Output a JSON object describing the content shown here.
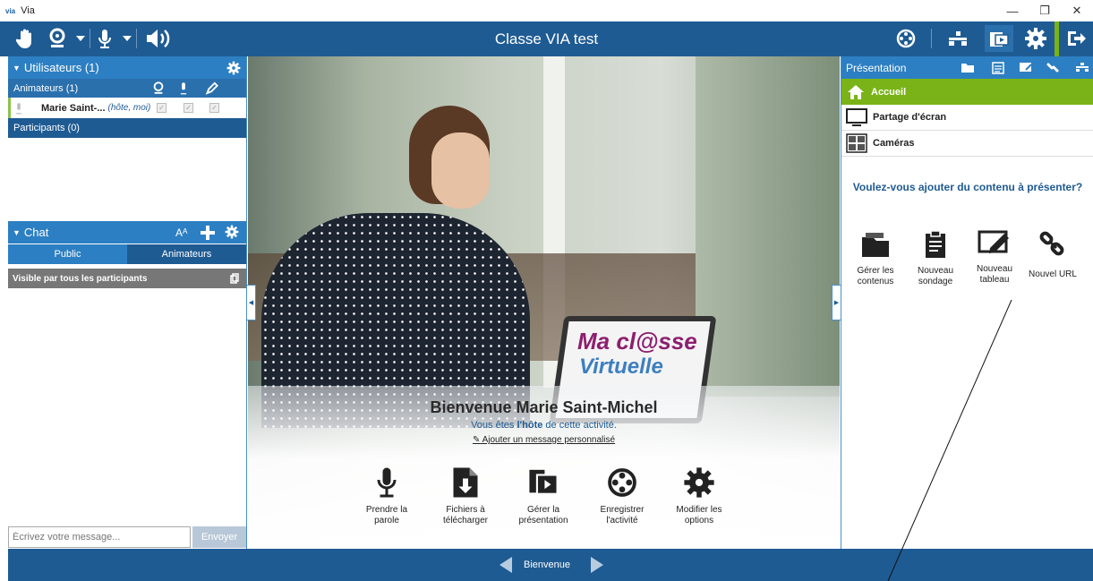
{
  "window": {
    "logo": "via",
    "title": "Via",
    "minimize": "—",
    "restore": "❐",
    "close": "✕"
  },
  "toolbar": {
    "class_title": "Classe VIA test"
  },
  "users": {
    "header": "Utilisateurs (1)",
    "animators_header": "Animateurs (1)",
    "user_name": "Marie Saint-...",
    "user_tag": "(hôte, moi)",
    "participants_header": "Participants (0)"
  },
  "chat": {
    "header": "Chat",
    "font_label": "Aᴬ",
    "tabs": [
      "Public",
      "Animateurs"
    ],
    "visibility": "Visible par tous les participants",
    "input_placeholder": "Écrivez votre message...",
    "send_label": "Envoyer"
  },
  "welcome": {
    "title": "Bienvenue Marie Saint-Michel",
    "subtitle_pre": "Vous êtes ",
    "subtitle_bold": "l'hôte",
    "subtitle_post": " de cette activité.",
    "custom_message_link": "Ajouter un message personnalisé",
    "screen_text_1": "Ma cl@sse",
    "screen_text_2": "Virtuelle",
    "actions": [
      {
        "line1": "Prendre la",
        "line2": "parole",
        "icon": "microphone-icon"
      },
      {
        "line1": "Fichiers à",
        "line2": "télécharger",
        "icon": "download-file-icon"
      },
      {
        "line1": "Gérer la",
        "line2": "présentation",
        "icon": "presentation-icon"
      },
      {
        "line1": "Enregistrer",
        "line2": "l'activité",
        "icon": "film-reel-icon"
      },
      {
        "line1": "Modifier les",
        "line2": "options",
        "icon": "gear-icon"
      }
    ]
  },
  "presentation": {
    "header": "Présentation",
    "items": [
      "Accueil",
      "Partage d'écran",
      "Caméras"
    ],
    "question": "Voulez-vous ajouter du contenu à présenter?",
    "tools": [
      {
        "line1": "Gérer les",
        "line2": "contenus"
      },
      {
        "line1": "Nouveau",
        "line2": "sondage"
      },
      {
        "line1": "Nouveau",
        "line2": "tableau"
      },
      {
        "line1": "Nouvel URL",
        "line2": ""
      }
    ]
  },
  "bottom": {
    "page_label": "Bienvenue"
  },
  "colors": {
    "primary": "#1f5b93",
    "header_blue": "#2c7fc2",
    "active_green": "#7ab317",
    "accent_link": "#1f5b93"
  }
}
